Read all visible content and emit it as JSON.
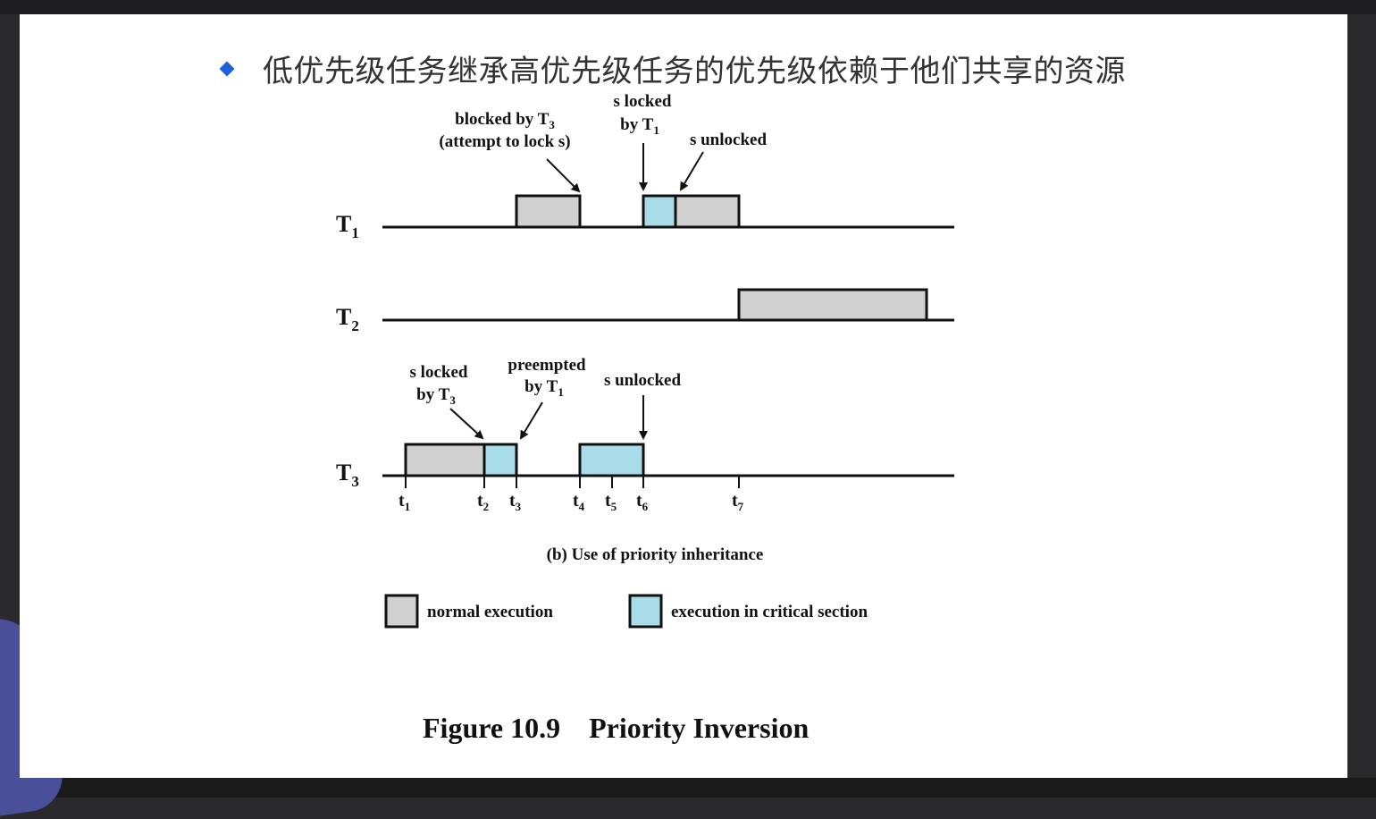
{
  "heading": "低优先级任务继承高优先级任务的优先级依赖于他们共享的资源",
  "tasks": [
    {
      "id": "T1",
      "name": "T",
      "sub": "1"
    },
    {
      "id": "T2",
      "name": "T",
      "sub": "2"
    },
    {
      "id": "T3",
      "name": "T",
      "sub": "3"
    }
  ],
  "time_marks": [
    {
      "name": "t",
      "sub": "1"
    },
    {
      "name": "t",
      "sub": "2"
    },
    {
      "name": "t",
      "sub": "3"
    },
    {
      "name": "t",
      "sub": "4"
    },
    {
      "name": "t",
      "sub": "5"
    },
    {
      "name": "t",
      "sub": "6"
    },
    {
      "name": "t",
      "sub": "7"
    }
  ],
  "execution_blocks": [
    {
      "task": "T1",
      "start": "t4",
      "end": "t_blocked",
      "kind": "normal"
    },
    {
      "task": "T1",
      "start": "t6",
      "end": "t_mid",
      "kind": "critical"
    },
    {
      "task": "T1",
      "start": "t_mid",
      "end": "t7",
      "kind": "normal"
    },
    {
      "task": "T2",
      "start": "t7",
      "end": "end",
      "kind": "normal"
    },
    {
      "task": "T3",
      "start": "t1",
      "end": "t2",
      "kind": "normal"
    },
    {
      "task": "T3",
      "start": "t2",
      "end": "t3",
      "kind": "critical"
    },
    {
      "task": "T3",
      "start": "t4",
      "end": "t6",
      "kind": "critical"
    }
  ],
  "annotations": {
    "t1_blocked_line1": "blocked by T",
    "t1_blocked_line1_sub": "3",
    "t1_blocked_line2": "(attempt to lock s)",
    "t1_locked_line1": "s locked",
    "t1_locked_line2": "by T",
    "t1_locked_line2_sub": "1",
    "t1_unlocked": "s unlocked",
    "t3_locked_line1": "s locked",
    "t3_locked_line2": "by T",
    "t3_locked_line2_sub": "3",
    "t3_preempted_line1": "preempted",
    "t3_preempted_line2": "by T",
    "t3_preempted_line2_sub": "1",
    "t3_unlocked": "s unlocked"
  },
  "caption": "(b) Use of priority inheritance",
  "legend": [
    {
      "label": "normal execution",
      "color": "#d0d0d0"
    },
    {
      "label": "execution in critical section",
      "color": "#a8dce8"
    }
  ],
  "figure_title": "Figure 10.9    Priority Inversion",
  "colors": {
    "normal": "#d0d0d0",
    "critical": "#a8dce8",
    "bullet": "#1a63d8"
  }
}
